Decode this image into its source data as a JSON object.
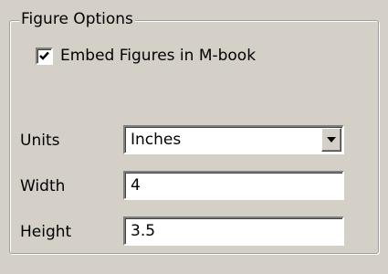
{
  "group": {
    "title": "Figure Options"
  },
  "embed_figures": {
    "label": "Embed Figures in M-book",
    "checked": true
  },
  "units": {
    "label": "Units",
    "value": "Inches"
  },
  "width": {
    "label": "Width",
    "value": "4"
  },
  "height": {
    "label": "Height",
    "value": "3.5"
  }
}
